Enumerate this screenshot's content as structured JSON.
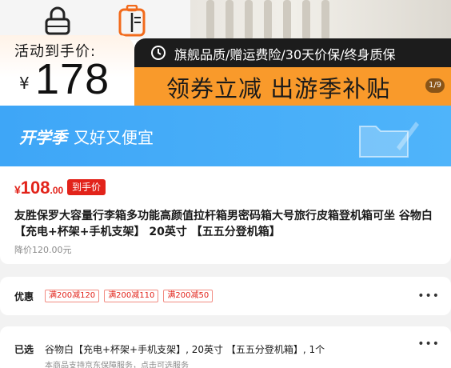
{
  "hero": {
    "promo_label": "活动到手价:",
    "currency": "¥",
    "big_price": "178",
    "band_text": "旗舰品质/赠运费险/30天价保/终身质保",
    "orange_text": "领券立减 出游季补贴",
    "pager": "1/9"
  },
  "campaign": {
    "title": "开学季",
    "subtitle": "又好又便宜"
  },
  "product": {
    "currency": "¥",
    "price_int": "108",
    "price_dec": ".00",
    "price_tag": "到手价",
    "title": "友胜保罗大容量行李箱多功能高颜值拉杆箱男密码箱大号旅行皮箱登机箱可坐 谷物白【充电+杯架+手机支架】 20英寸 【五五分登机箱】",
    "original_price": "降价120.00元"
  },
  "coupons": {
    "label": "优惠",
    "items": [
      "满200减120",
      "满200减110",
      "满200减50"
    ],
    "more": "•••"
  },
  "selected": {
    "label": "已选",
    "value": "谷物白【充电+杯架+手机支架】, 20英寸 【五五分登机箱】, 1个",
    "note": "本商品支持京东保障服务，点击可选服务",
    "more": "•••"
  },
  "colors": {
    "price_red": "#e2231a",
    "banner_orange": "#f99a2b",
    "campaign_blue": "#3ea6f7",
    "dark_band": "#1c1c1c"
  }
}
